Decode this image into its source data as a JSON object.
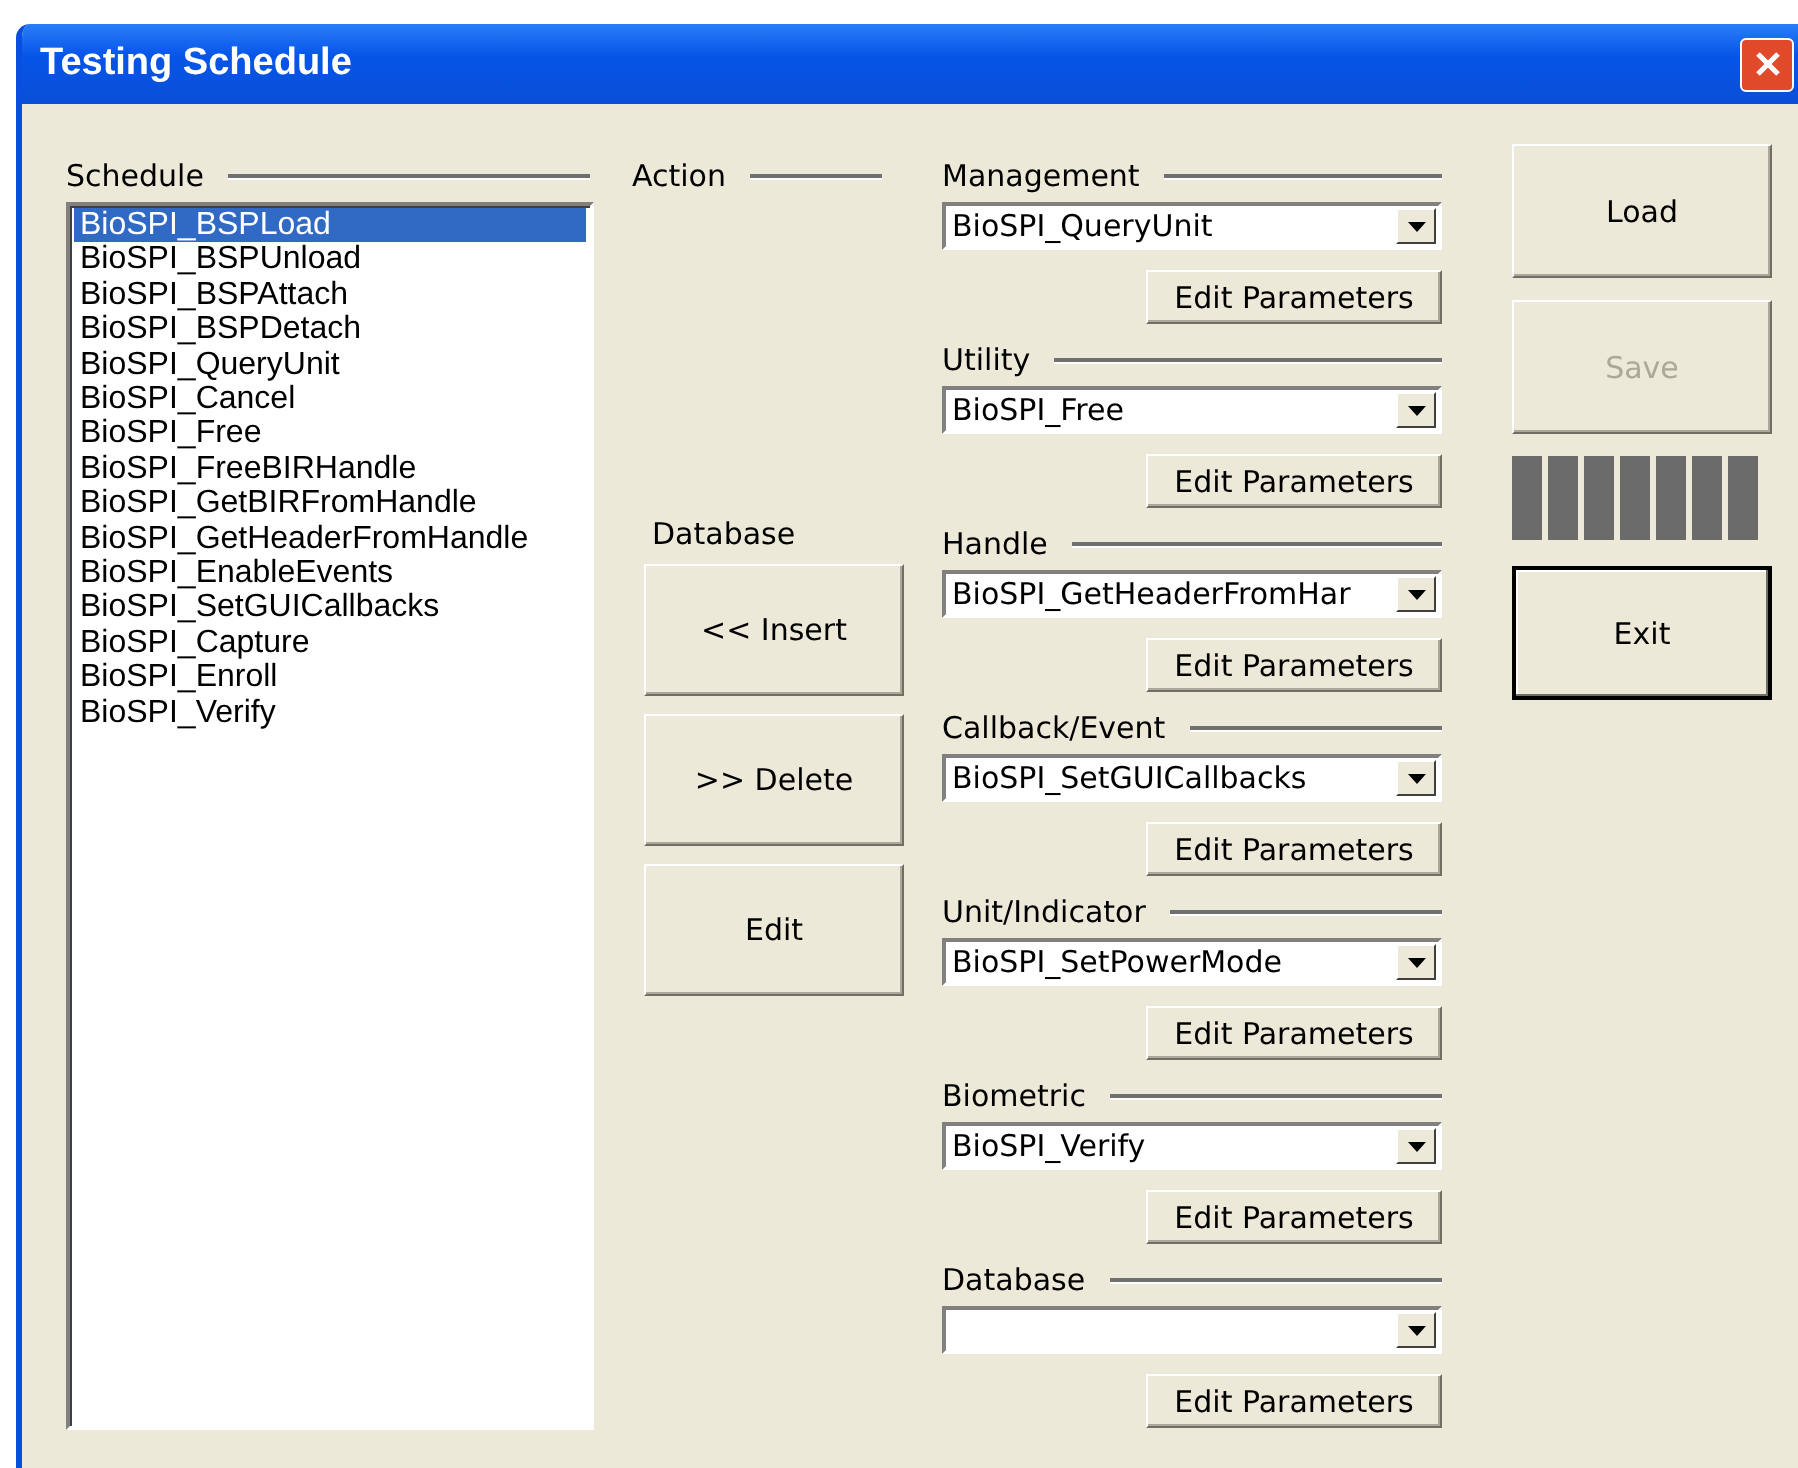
{
  "window": {
    "title": "Testing Schedule"
  },
  "schedule": {
    "label": "Schedule",
    "items": [
      {
        "text": "BioSPI_BSPLoad",
        "selected": true
      },
      {
        "text": "BioSPI_BSPUnload",
        "selected": false
      },
      {
        "text": "BioSPI_BSPAttach",
        "selected": false
      },
      {
        "text": "BioSPI_BSPDetach",
        "selected": false
      },
      {
        "text": "BioSPI_QueryUnit",
        "selected": false
      },
      {
        "text": "BioSPI_Cancel",
        "selected": false
      },
      {
        "text": "BioSPI_Free",
        "selected": false
      },
      {
        "text": "BioSPI_FreeBIRHandle",
        "selected": false
      },
      {
        "text": "BioSPI_GetBIRFromHandle",
        "selected": false
      },
      {
        "text": "BioSPI_GetHeaderFromHandle",
        "selected": false
      },
      {
        "text": "BioSPI_EnableEvents",
        "selected": false
      },
      {
        "text": "BioSPI_SetGUICallbacks",
        "selected": false
      },
      {
        "text": "BioSPI_Capture",
        "selected": false
      },
      {
        "text": "BioSPI_Enroll",
        "selected": false
      },
      {
        "text": "BioSPI_Verify",
        "selected": false
      }
    ]
  },
  "action": {
    "label": "Action",
    "database_label": "Database",
    "buttons": [
      {
        "label": "<< Insert"
      },
      {
        "label": ">> Delete"
      },
      {
        "label": "Edit"
      }
    ]
  },
  "groups": [
    {
      "label": "Management",
      "value": "BioSPI_QueryUnit",
      "button": "Edit Parameters"
    },
    {
      "label": "Utility",
      "value": "BioSPI_Free",
      "button": "Edit Parameters"
    },
    {
      "label": "Handle",
      "value": "BioSPI_GetHeaderFromHar",
      "button": "Edit Parameters"
    },
    {
      "label": "Callback/Event",
      "value": "BioSPI_SetGUICallbacks",
      "button": "Edit Parameters"
    },
    {
      "label": "Unit/Indicator",
      "value": "BioSPI_SetPowerMode",
      "button": "Edit Parameters"
    },
    {
      "label": "Biometric",
      "value": "BioSPI_Verify",
      "button": "Edit Parameters"
    },
    {
      "label": "Database",
      "button": "Edit Parameters"
    }
  ],
  "side_buttons": [
    {
      "label": "Load",
      "disabled": false,
      "default": false
    },
    {
      "label": "Save",
      "disabled": true,
      "default": false
    }
  ],
  "progress": {
    "level": 1
  },
  "exit_button": {
    "label": "Exit",
    "disabled": false,
    "default": true
  }
}
